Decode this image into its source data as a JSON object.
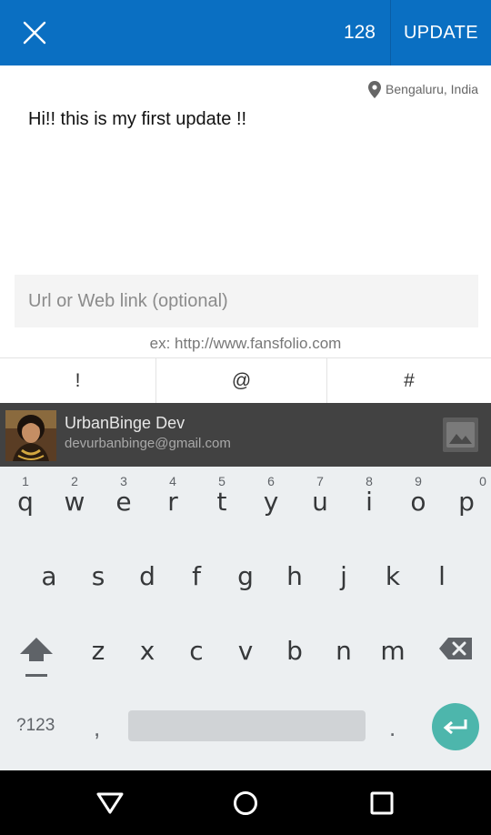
{
  "topbar": {
    "char_count": "128",
    "update_label": "UPDATE",
    "background_color": "#0a6fc2"
  },
  "location": {
    "icon": "location-pin-icon",
    "text": "Bengaluru, India"
  },
  "composer": {
    "text": "Hi!! this is my first update !!"
  },
  "url": {
    "value": "",
    "placeholder": "Url or Web link (optional)",
    "hint": "ex: http://www.fansfolio.com"
  },
  "symbols": [
    "!",
    "@",
    "#"
  ],
  "account": {
    "name": "UrbanBinge Dev",
    "email": "devurbanbinge@gmail.com"
  },
  "keyboard": {
    "row1": [
      {
        "letter": "q",
        "num": "1"
      },
      {
        "letter": "w",
        "num": "2"
      },
      {
        "letter": "e",
        "num": "3"
      },
      {
        "letter": "r",
        "num": "4"
      },
      {
        "letter": "t",
        "num": "5"
      },
      {
        "letter": "y",
        "num": "6"
      },
      {
        "letter": "u",
        "num": "7"
      },
      {
        "letter": "i",
        "num": "8"
      },
      {
        "letter": "o",
        "num": "9"
      },
      {
        "letter": "p",
        "num": "0"
      }
    ],
    "row2": [
      "a",
      "s",
      "d",
      "f",
      "g",
      "h",
      "j",
      "k",
      "l"
    ],
    "row3": [
      "z",
      "x",
      "c",
      "v",
      "b",
      "n",
      "m"
    ],
    "symbols_label": "?123",
    "comma": ",",
    "period": ".",
    "enter_color": "#4db6ac"
  },
  "navbar": {
    "back_icon": "back-triangle-icon",
    "home_icon": "home-circle-icon",
    "recents_icon": "recents-square-icon"
  }
}
